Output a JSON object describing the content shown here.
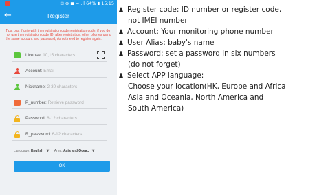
{
  "statusbar": {
    "right_text": "⊟ ⊗ ◼ ≈ .ıl 64% ▮ 15:15"
  },
  "titlebar": {
    "back_glyph": "←",
    "title": "Register"
  },
  "tips": "Tips: pro, if only with the registration code registration code, if you do not use the registration code ID, after registration, other phones using the same account and password, do not need to register again.",
  "form": {
    "license": {
      "label": "License:",
      "placeholder": "10,15 characters"
    },
    "account": {
      "label": "Account:",
      "placeholder": "Email"
    },
    "nickname": {
      "label": "Nickname:",
      "placeholder": "2-30 characters"
    },
    "p_number": {
      "label": "P_number:",
      "placeholder": "Retrieve password"
    },
    "password": {
      "label": "Password:",
      "placeholder": "6-12 characters"
    },
    "r_password": {
      "label": "R_password:",
      "placeholder": "6-12 characters"
    },
    "language": {
      "label": "Language:",
      "value": "English",
      "caret": "▼"
    },
    "area": {
      "label": "Area:",
      "value": "Asia and Ocea..",
      "caret": "▼"
    },
    "ok_label": "OK"
  },
  "notes": [
    {
      "bullet": true,
      "text": "Register code: ID number or register code,"
    },
    {
      "bullet": false,
      "text": "not IMEI number"
    },
    {
      "bullet": true,
      "text": "Account: Your monitoring phone number"
    },
    {
      "bullet": true,
      "text": "User Alias: baby's name"
    },
    {
      "bullet": true,
      "text": "Password: set a password in six numbers"
    },
    {
      "bullet": false,
      "text": "(do not forget)"
    },
    {
      "bullet": true,
      "text": "Select APP language:"
    },
    {
      "bullet": false,
      "text": "Choose your location(HK, Europe and Africa"
    },
    {
      "bullet": false,
      "text": "Asia and Oceania, North America and"
    },
    {
      "bullet": false,
      "text": "South America)"
    }
  ],
  "colors": {
    "primary": "#1e9be9",
    "tip_red": "#e8483c",
    "bg": "#eef1f4"
  }
}
